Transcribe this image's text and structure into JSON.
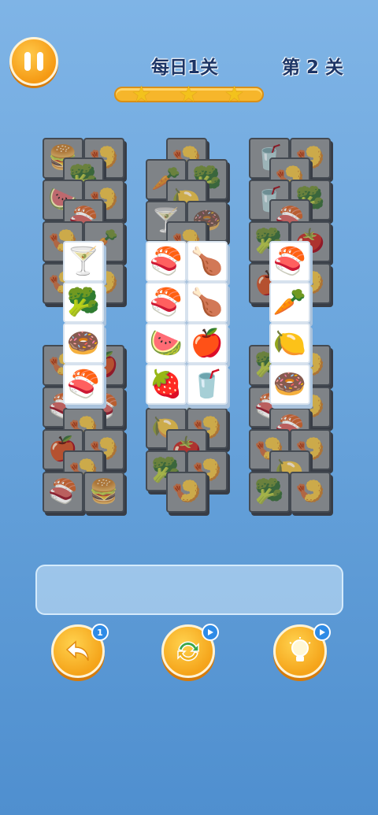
{
  "header": {
    "daily_label": "每日1关",
    "level_label": "第 2 关",
    "stars": [
      "★",
      "★",
      "★"
    ]
  },
  "tool_badges": {
    "undo": "1"
  },
  "colors": {
    "accent_orange": "#f5a41a",
    "badge_blue": "#2f8be6",
    "background_top": "#7fb4e6"
  },
  "tile_icons": {
    "burger": "burger-icon",
    "shrimp": "shrimp-icon",
    "broccoli": "broccoli-icon",
    "salmon": "salmon-icon",
    "drink": "drink-icon",
    "cocktail": "cocktail-icon",
    "lime": "lime-icon",
    "donut": "donut-icon",
    "tomato": "tomato-icon",
    "carrot": "carrot-icon",
    "drumstick": "drumstick-icon",
    "watermelon": "watermelon-icon",
    "apple": "apple-icon",
    "strawberry": "strawberry-icon"
  }
}
